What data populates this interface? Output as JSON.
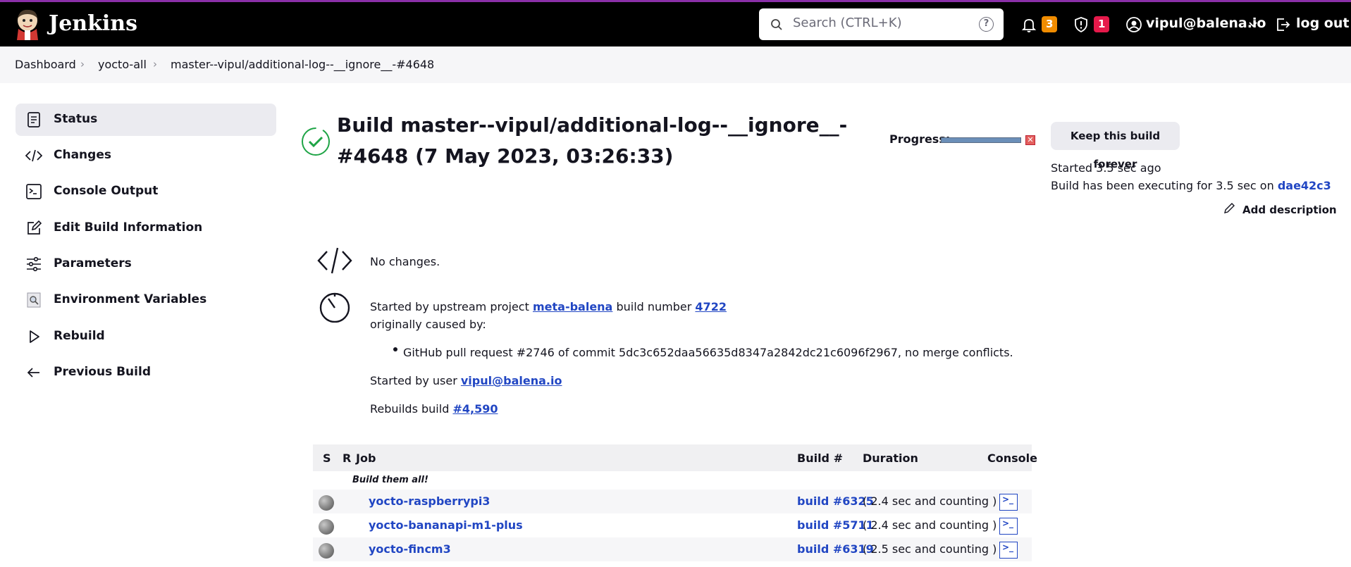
{
  "header": {
    "brand": "Jenkins",
    "search_placeholder": "Search (CTRL+K)",
    "help": "?",
    "notifications_count": "3",
    "security_count": "1",
    "user": "vipul@balena.io",
    "logout": "log out",
    "colors": {
      "notifications_badge": "#f08c00",
      "security_badge": "#e5194a"
    }
  },
  "breadcrumb": {
    "items": [
      "Dashboard",
      "yocto-all",
      "master--vipul/additional-log--__ignore__-#4648"
    ]
  },
  "sidebar": {
    "items": [
      {
        "label": "Status",
        "icon": "document-icon"
      },
      {
        "label": "Changes",
        "icon": "code-icon"
      },
      {
        "label": "Console Output",
        "icon": "terminal-icon"
      },
      {
        "label": "Edit Build Information",
        "icon": "edit-icon"
      },
      {
        "label": "Parameters",
        "icon": "sliders-icon"
      },
      {
        "label": "Environment Variables",
        "icon": "magnifier-doc-icon"
      },
      {
        "label": "Rebuild",
        "icon": "play-icon"
      },
      {
        "label": "Previous Build",
        "icon": "arrow-left-icon"
      }
    ]
  },
  "build": {
    "title": "Build master--vipul/additional-log--__ignore__-#4648 (7 May 2023, 03:26:33)",
    "progress_label": "Progress:",
    "progress_value": 1.0,
    "keep_button": "Keep this build forever",
    "started": "Started 3.5 sec ago",
    "executing_prefix": "Build has been executing for 3.5 sec on",
    "executor": "dae42c3",
    "add_description": "Add description",
    "no_changes": "No changes.",
    "upstream_prefix": "Started by upstream project",
    "upstream_project": "meta-balena",
    "upstream_mid": "build number",
    "upstream_build": "4722",
    "caused_by": "originally caused by:",
    "cause_item": "GitHub pull request #2746 of commit 5dc3c652daa56635d8347a2842dc21c6096f2967, no merge conflicts.",
    "started_by_prefix": "Started by user",
    "started_by_user": "vipul@balena.io",
    "rebuilds_prefix": "Rebuilds build",
    "rebuilds_build": "#4,590"
  },
  "table": {
    "headers": {
      "s": "S",
      "r": "R",
      "job": "Job",
      "build": "Build #",
      "duration": "Duration",
      "console": "Console"
    },
    "group": "Build them all!",
    "rows": [
      {
        "job": "yocto-raspberrypi3",
        "build": "build #6325",
        "duration": "( 2.4 sec and counting )"
      },
      {
        "job": "yocto-bananapi-m1-plus",
        "build": "build #5711",
        "duration": "( 2.4 sec and counting )"
      },
      {
        "job": "yocto-fincm3",
        "build": "build #6319",
        "duration": "( 2.5 sec and counting )"
      }
    ]
  }
}
